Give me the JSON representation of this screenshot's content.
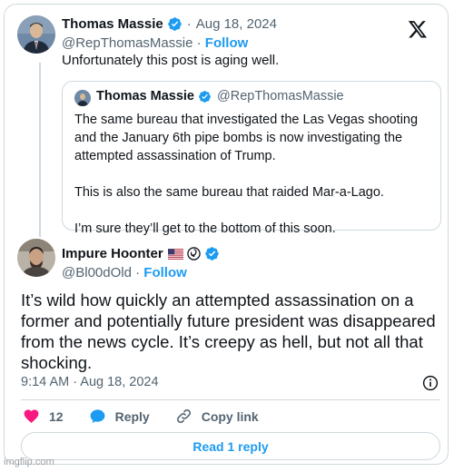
{
  "original_post": {
    "author_name": "Thomas Massie",
    "separator": "·",
    "date": "Aug 18, 2024",
    "handle": "@RepThomasMassie",
    "handle_separator": " · ",
    "follow_label": "Follow",
    "text": "Unfortunately this post is aging well."
  },
  "quoted_post": {
    "author_name": "Thomas Massie",
    "handle": "@RepThomasMassie",
    "paragraphs": [
      "The same bureau that investigated the Las Vegas shooting and the January 6th pipe bombs is now investigating the attempted assassination of Trump.",
      "This is also the same bureau that raided Mar-a-Lago.",
      "I’m sure they’ll get to the bottom of this soon."
    ]
  },
  "reply_post": {
    "author_name": "Impure Hoonter",
    "handle": "@Bl00dOld",
    "handle_separator": " · ",
    "follow_label": "Follow",
    "text": "It’s wild how quickly an attempted assassination on a former and potentially future president was disappeared from the news cycle. It’s creepy as hell, but not all that shocking.",
    "timestamp": "9:14 AM · Aug 18, 2024"
  },
  "actions": {
    "like_count": "12",
    "reply_label": "Reply",
    "copy_link_label": "Copy link",
    "read_replies_label": "Read 1 reply"
  },
  "icons": [
    "x-logo-icon",
    "verified-badge-icon",
    "us-flag-icon",
    "swirl-emoji-icon",
    "info-icon",
    "heart-icon",
    "reply-bubble-icon",
    "link-icon"
  ],
  "colors": {
    "accent": "#1d9bf0",
    "like": "#f91880",
    "text_primary": "#0f1419",
    "text_secondary": "#536471",
    "border": "#cfd9de"
  },
  "watermark": "imgflip.com"
}
